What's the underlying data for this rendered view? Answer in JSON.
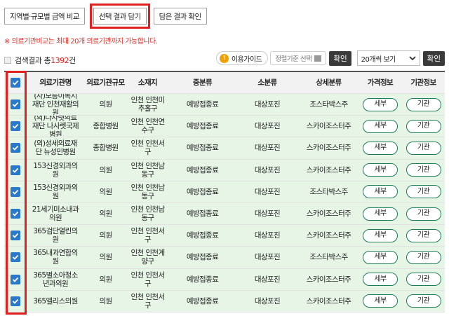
{
  "tabs": {
    "compare": "지역별·규모별 금액 비교",
    "add_selected": "선택 결과 담기",
    "view_selected": "담은 결과 확인"
  },
  "notice": "※ 의료기관비교는 최대 20개 의료기관까지 가능합니다.",
  "result": {
    "prefix": "검색결과 총",
    "count": "1392",
    "suffix": "건"
  },
  "toolbar": {
    "guide_label": "이용가이드",
    "sort_label": "정렬기준 선택",
    "confirm_label": "확인",
    "page_size": "20개씩 보기",
    "confirm2_label": "확인"
  },
  "table": {
    "headers": [
      "의료기관명",
      "의료기관규모",
      "소재지",
      "중분류",
      "소분류",
      "상세분류",
      "가격정보",
      "기관정보"
    ],
    "price_button": "세부",
    "org_button": "기관",
    "rows": [
      {
        "name": "(사)모퉁이복지재단 인천재활의원",
        "size": "의원",
        "loc": "인천 인천미추홀구",
        "mid": "예방접종료",
        "sub": "대상포진",
        "detail": "조스타박스주"
      },
      {
        "name": "(의)나사렛의료재단 나사렛국제병원",
        "size": "종합병원",
        "loc": "인천 인천연수구",
        "mid": "예방접종료",
        "sub": "대상포진",
        "detail": "스카이조스터주"
      },
      {
        "name": "(의)성세의료재단 뉴성민병원",
        "size": "종합병원",
        "loc": "인천 인천서구",
        "mid": "예방접종료",
        "sub": "대상포진",
        "detail": "스카이조스터주"
      },
      {
        "name": "153신경외과의원",
        "size": "의원",
        "loc": "인천 인천남동구",
        "mid": "예방접종료",
        "sub": "대상포진",
        "detail": "스카이조스터주"
      },
      {
        "name": "153신경외과의원",
        "size": "의원",
        "loc": "인천 인천남동구",
        "mid": "예방접종료",
        "sub": "대상포진",
        "detail": "조스타박스주"
      },
      {
        "name": "21세기미소내과의원",
        "size": "의원",
        "loc": "인천 인천남동구",
        "mid": "예방접종료",
        "sub": "대상포진",
        "detail": "스카이조스터주"
      },
      {
        "name": "365검단열린의원",
        "size": "의원",
        "loc": "인천 인천서구",
        "mid": "예방접종료",
        "sub": "대상포진",
        "detail": "스카이조스터주"
      },
      {
        "name": "365내과연합의원",
        "size": "의원",
        "loc": "인천 인천계양구",
        "mid": "예방접종료",
        "sub": "대상포진",
        "detail": "조스타박스주"
      },
      {
        "name": "365별소아청소년과의원",
        "size": "의원",
        "loc": "인천 인천서구",
        "mid": "예방접종료",
        "sub": "대상포진",
        "detail": "스카이조스터주"
      },
      {
        "name": "365엘리스의원",
        "size": "의원",
        "loc": "인천 인천서구",
        "mid": "예방접종료",
        "sub": "대상포진",
        "detail": "스카이조스터주"
      }
    ]
  },
  "colors": {
    "accent_red": "#e02020",
    "row_green": "#e7f5e7",
    "checkbox_blue": "#2a78c9",
    "pill_border": "#1c7a55"
  }
}
